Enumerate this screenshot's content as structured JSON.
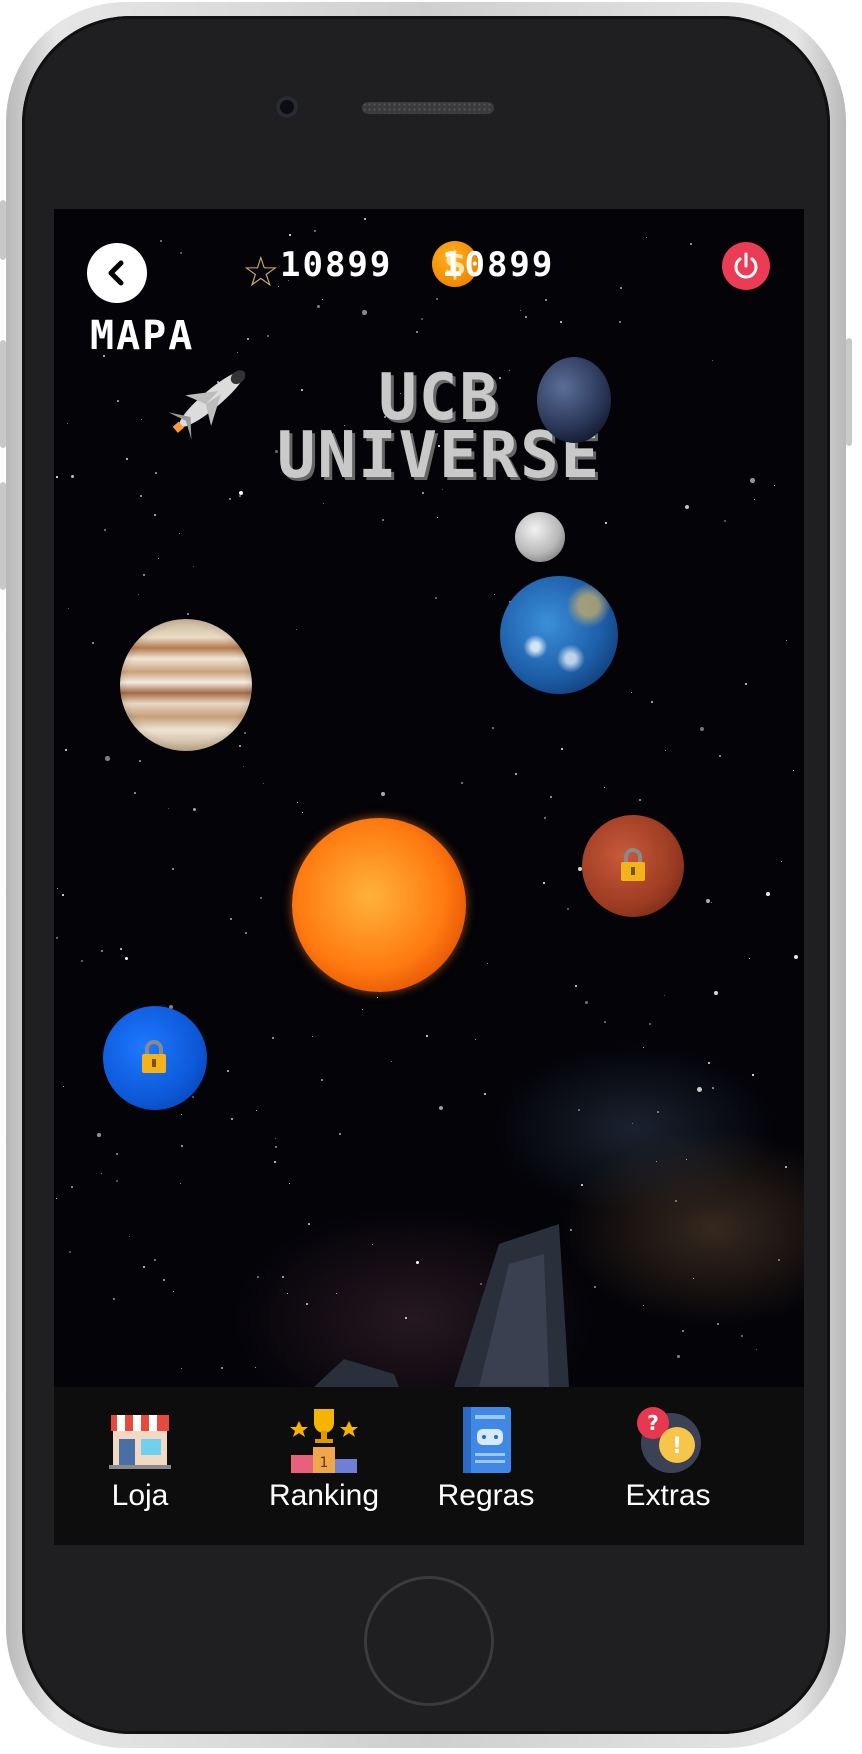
{
  "header": {
    "stars": "10899",
    "coins": "10899",
    "page_title": "MAPA"
  },
  "title": {
    "line1": "UCB",
    "line2": "UNIVERSE"
  },
  "planets": [
    {
      "name": "jupiter",
      "locked": false
    },
    {
      "name": "earth",
      "locked": false
    },
    {
      "name": "moon",
      "locked": false
    },
    {
      "name": "sun",
      "locked": false
    },
    {
      "name": "mars",
      "locked": true
    },
    {
      "name": "neptune",
      "locked": true
    },
    {
      "name": "dark-planet",
      "locked": false
    }
  ],
  "nav": {
    "items": [
      {
        "label": "Loja",
        "icon": "store-icon"
      },
      {
        "label": "Ranking",
        "icon": "trophy-podium-icon"
      },
      {
        "label": "Regras",
        "icon": "rulebook-icon"
      },
      {
        "label": "Extras",
        "icon": "question-alert-icon"
      }
    ]
  },
  "colors": {
    "power": "#ec3b54",
    "coin": "#f08a00",
    "nav_bg": "#0d0d0d"
  }
}
